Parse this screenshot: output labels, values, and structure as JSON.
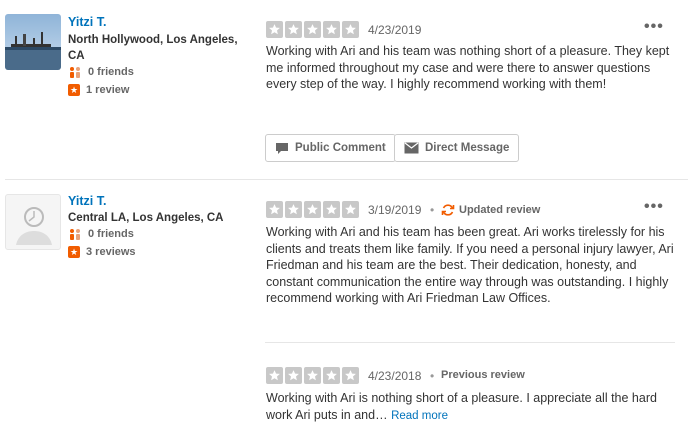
{
  "colors": {
    "link": "#0073bb",
    "star_empty": "#c8c8c8",
    "brand": "#f15c00"
  },
  "reviews": [
    {
      "user": {
        "name": "Yitzi T.",
        "location": "North Hollywood, Los Angeles, CA",
        "friends": "0 friends",
        "reviews": "1 review"
      },
      "date": "4/23/2019",
      "rating": 0,
      "text": "Working with Ari and his team was nothing short of a pleasure. They kept me informed throughout my case and were there to answer questions every step of the way. I highly recommend working with them!",
      "buttons": {
        "public_comment": "Public Comment",
        "direct_message": "Direct Message"
      }
    },
    {
      "user": {
        "name": "Yitzi T.",
        "location": "Central LA, Los Angeles, CA",
        "friends": "0 friends",
        "reviews": "3 reviews"
      },
      "date": "3/19/2019",
      "tag": "Updated review",
      "rating": 0,
      "text": "Working with Ari and his team has been great. Ari works tirelessly for his clients and treats them like family. If you need a personal injury lawyer, Ari Friedman and his team are the best. Their dedication, honesty, and constant communication the entire way through was outstanding. I highly recommend working with Ari Friedman Law Offices.",
      "previous": {
        "date": "4/23/2018",
        "tag": "Previous review",
        "text": "Working with Ari is nothing short of a pleasure. I appreciate all the hard work Ari puts in and…",
        "read_more": "Read more"
      }
    }
  ],
  "separator": "•",
  "more_glyph": "•••"
}
